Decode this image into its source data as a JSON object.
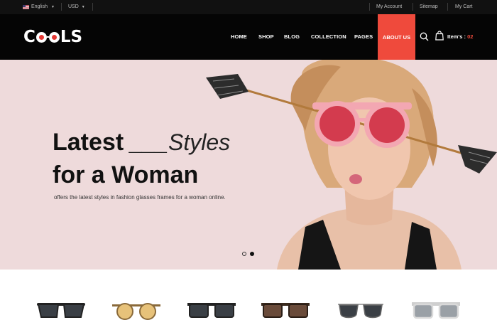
{
  "topbar": {
    "language": "English",
    "currency": "USD",
    "links": {
      "account": "My Account",
      "sitemap": "Sitemap",
      "cart": "My Cart"
    }
  },
  "header": {
    "logo": {
      "start": "C",
      "end": "LS"
    },
    "nav": [
      "HOME",
      "SHOP",
      "BLOG",
      "COLLECTION",
      "PAGES"
    ],
    "nav_active": "ABOUT US",
    "cart_label": "Item's :",
    "cart_count": "02",
    "icons": [
      "search-icon",
      "shopping-bag-icon"
    ]
  },
  "hero": {
    "title_bold_1": "Latest",
    "title_blank": "___",
    "title_light": "Styles",
    "title_line_2": "for a Woman",
    "subtitle": "offers the latest styles in fashion glasses frames for a woman online.",
    "slides_total": 2,
    "slide_active": 2
  },
  "products": [
    "black-wayfarer-sunglasses",
    "tan-round-sunglasses",
    "black-square-sunglasses",
    "brown-square-sunglasses",
    "black-aviator-sunglasses",
    "grey-square-sunglasses"
  ],
  "colors": {
    "accent": "#ef4a3c",
    "header_bg": "#050505",
    "hero_bg": "#eedadb"
  }
}
